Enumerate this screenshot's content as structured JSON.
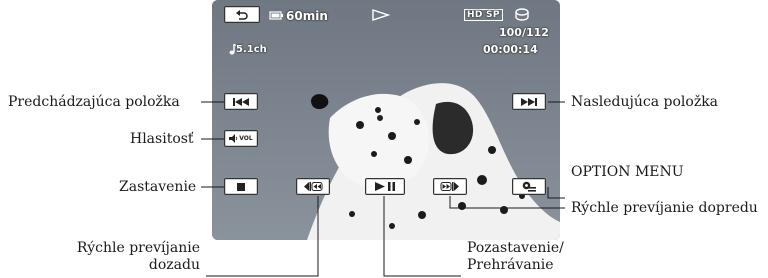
{
  "screen": {
    "battery_time": "60min",
    "quality_badge": "HD SP",
    "counter": "100/112",
    "timecode": "00:00:14",
    "audio_mode": "5.1ch",
    "volume_label": "VOL"
  },
  "labels": {
    "previous": "Predchádzajúca položka",
    "volume": "Hlasitosť",
    "stop": "Zastavenie",
    "rewind_line1": "Rýchle prevíjanie",
    "rewind_line2": "dozadu",
    "next": "Nasledujúca položka",
    "option_menu": "OPTION MENU",
    "fast_forward": "Rýchle prevíjanie dopredu",
    "pause_line1": "Pozastavenie/",
    "pause_line2": "Prehrávanie"
  },
  "icons": [
    "return-icon",
    "battery-icon",
    "play-indicator-icon",
    "hd-sp-badge",
    "media-icon",
    "music-note-icon",
    "previous-icon",
    "speaker-icon",
    "stop-icon",
    "rewind-icon",
    "play-pause-icon",
    "fast-forward-icon",
    "next-icon",
    "option-menu-icon"
  ]
}
